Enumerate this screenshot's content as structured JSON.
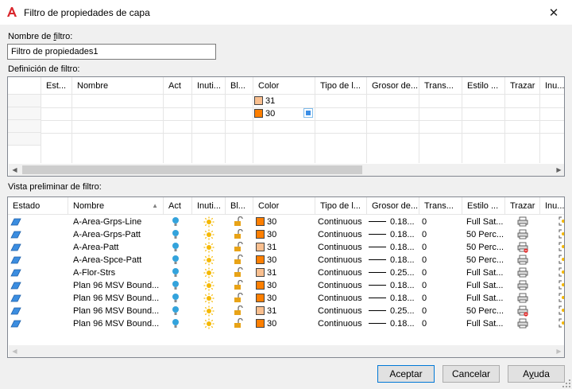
{
  "window": {
    "title": "Filtro de propiedades de capa"
  },
  "filter_name": {
    "label_pre": "Nombre de ",
    "label_ul": "f",
    "label_post": "iltro:",
    "value": "Filtro de propiedades1"
  },
  "definition": {
    "label": "Definición de filtro:",
    "columns": [
      "",
      "Est...",
      "Nombre",
      "Act",
      "Inuti...",
      "Bl...",
      "Color",
      "Tipo de l...",
      "Grosor de...",
      "Trans...",
      "Estilo ...",
      "Trazar",
      "Inu..."
    ],
    "rows": [
      {
        "color": "31",
        "swatch": "#f9bf8f"
      },
      {
        "color": "30",
        "swatch": "#fe7f00"
      }
    ]
  },
  "preview": {
    "label": "Vista preliminar de filtro:",
    "columns": [
      "Estado",
      "Nombre",
      "Act",
      "Inuti...",
      "Bl...",
      "Color",
      "Tipo de l...",
      "Grosor de...",
      "Trans...",
      "Estilo ...",
      "Trazar",
      "Inu..."
    ],
    "rows": [
      {
        "name": "A-Area-Grps-Line",
        "color": "30",
        "swatch": "#fe7f00",
        "linetype": "Continuous",
        "lineweight": "0.18...",
        "trans": "0",
        "style": "Full Sat...",
        "noplot": false
      },
      {
        "name": "A-Area-Grps-Patt",
        "color": "30",
        "swatch": "#fe7f00",
        "linetype": "Continuous",
        "lineweight": "0.18...",
        "trans": "0",
        "style": "50 Perc...",
        "noplot": false
      },
      {
        "name": "A-Area-Patt",
        "color": "31",
        "swatch": "#f9bf8f",
        "linetype": "Continuous",
        "lineweight": "0.18...",
        "trans": "0",
        "style": "50 Perc...",
        "noplot": true
      },
      {
        "name": "A-Area-Spce-Patt",
        "color": "30",
        "swatch": "#fe7f00",
        "linetype": "Continuous",
        "lineweight": "0.18...",
        "trans": "0",
        "style": "50 Perc...",
        "noplot": false
      },
      {
        "name": "A-Flor-Strs",
        "color": "31",
        "swatch": "#f9bf8f",
        "linetype": "Continuous",
        "lineweight": "0.25...",
        "trans": "0",
        "style": "Full Sat...",
        "noplot": false
      },
      {
        "name": "Plan 96 MSV Bound...",
        "color": "30",
        "swatch": "#fe7f00",
        "linetype": "Continuous",
        "lineweight": "0.18...",
        "trans": "0",
        "style": "Full Sat...",
        "noplot": false
      },
      {
        "name": "Plan 96 MSV Bound...",
        "color": "30",
        "swatch": "#fe7f00",
        "linetype": "Continuous",
        "lineweight": "0.18...",
        "trans": "0",
        "style": "Full Sat...",
        "noplot": false
      },
      {
        "name": "Plan 96 MSV Bound...",
        "color": "31",
        "swatch": "#f9bf8f",
        "linetype": "Continuous",
        "lineweight": "0.25...",
        "trans": "0",
        "style": "50 Perc...",
        "noplot": true
      },
      {
        "name": "Plan 96 MSV Bound...",
        "color": "30",
        "swatch": "#fe7f00",
        "linetype": "Continuous",
        "lineweight": "0.18...",
        "trans": "0",
        "style": "Full Sat...",
        "noplot": false
      }
    ]
  },
  "buttons": {
    "accept": "Aceptar",
    "cancel": "Cancelar",
    "help_pre": "A",
    "help_ul": "y",
    "help_post": "uda"
  },
  "colors": {
    "accent": "#0078d7",
    "lightbulb": "#33a3dc",
    "sun": "#f5b800",
    "lock": "#e8a317",
    "noplot": "#e02020"
  },
  "icons": {
    "status": "layer-status-icon",
    "on": "lightbulb-icon",
    "thaw": "sun-icon",
    "lock": "unlock-icon",
    "plot": "printer-icon",
    "vp": "viewport-freeze-icon"
  }
}
